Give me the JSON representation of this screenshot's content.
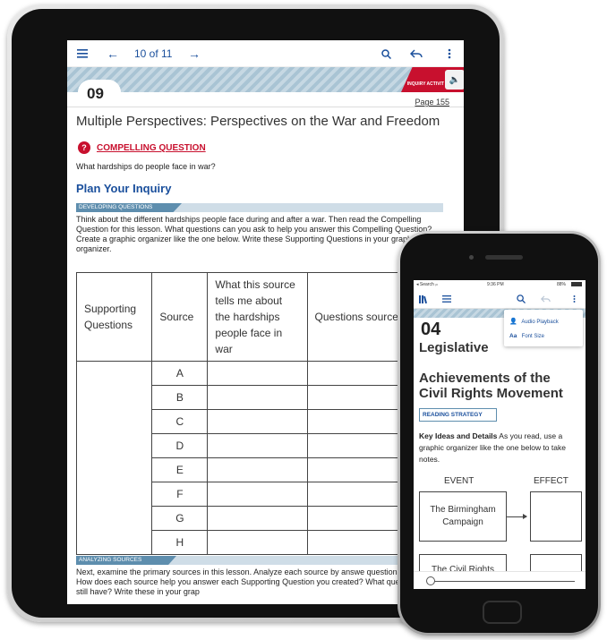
{
  "tablet": {
    "toolbar": {
      "menu_icon": "hamburger-icon",
      "back_icon": "arrow-left-icon",
      "pager": "10 of 11",
      "forward_icon": "arrow-right-icon",
      "search_icon": "search-icon",
      "undo_icon": "undo-icon",
      "more_icon": "more-vertical-icon"
    },
    "banner": {
      "chapter_number": "09",
      "inquiry_label": "INQUIRY ACTIVIT",
      "speaker_icon": "speaker-icon",
      "page_label": "Page 155"
    },
    "title": "Multiple Perspectives: Perspectives on the War and Freedom",
    "compelling": {
      "icon_glyph": "?",
      "label": "COMPELLING QUESTION",
      "text": "What hardships do people face in war?"
    },
    "plan_heading": "Plan Your Inquiry",
    "developing_tag": "DEVELOPING QUESTIONS",
    "developing_text": "Think about the different hardships people face during and after a war. Then read the Compelling Question for this lesson. What questions can you ask to help you answer this Compelling Question? Create a graphic organizer like the one below. Write these Supporting Questions in your graphic organizer.",
    "table": {
      "headers": [
        "Supporting Questions",
        "Source",
        "What this source tells me about the hardships people face in war",
        "Questions source le unanswe"
      ],
      "sources": [
        "A",
        "B",
        "C",
        "D",
        "E",
        "F",
        "G",
        "H"
      ]
    },
    "analyzing_tag": "ANALYZING SOURCES",
    "analyzing_text": "Next, examine the primary sources in this lesson. Analyze each source by answe questions that follow it. How does each source help you answer each Supporting Question you created? What questions do you still have? Write these in your grap"
  },
  "phone": {
    "status": {
      "left": "◂ Search  ᵢₗₗ",
      "time": "9:36 PM",
      "battery": "88%"
    },
    "toolbar": {
      "library_icon": "library-icon",
      "menu_icon": "hamburger-icon",
      "search_icon": "search-icon",
      "undo_icon": "undo-icon",
      "more_icon": "more-vertical-icon"
    },
    "menu": {
      "items": [
        {
          "icon": "audio-playback-icon",
          "label": "Audio Playback"
        },
        {
          "icon": "font-size-icon",
          "glyph": "Aa",
          "label": "Font Size"
        }
      ]
    },
    "chapter_number": "04",
    "heading_line1": "Legislative",
    "heading_line2": "Achievements of the Civil Rights Movement",
    "strategy_label": "READING STRATEGY",
    "para_bold": "Key Ideas and Details",
    "para_text": " As you read, use a graphic organizer like the one below to take notes.",
    "organizer": {
      "event_header": "EVENT",
      "effect_header": "EFFECT",
      "events": [
        "The Birmingham Campaign",
        "The Civil Rights"
      ]
    }
  }
}
